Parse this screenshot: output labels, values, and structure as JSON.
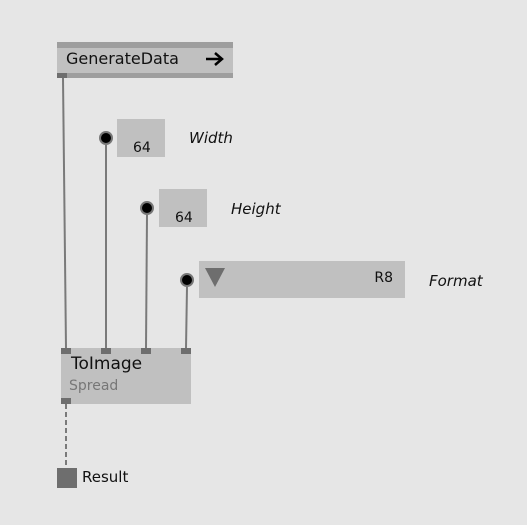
{
  "nodes": {
    "generate_data": {
      "title": "GenerateData",
      "icon": "arrow-right-icon"
    },
    "to_image": {
      "title": "ToImage",
      "subtitle": "Spread"
    }
  },
  "inputs": {
    "width": {
      "label": "Width",
      "value": "64"
    },
    "height": {
      "label": "Height",
      "value": "64"
    },
    "format": {
      "label": "Format",
      "value": "R8",
      "icon": "dropdown-triangle-icon"
    }
  },
  "output": {
    "label": "Result"
  },
  "colors": {
    "background": "#e6e6e6",
    "node": "#c0c0c0",
    "node_bar": "#9e9e9e",
    "pin": "#6e6e6e",
    "link": "#7a7a7a"
  }
}
